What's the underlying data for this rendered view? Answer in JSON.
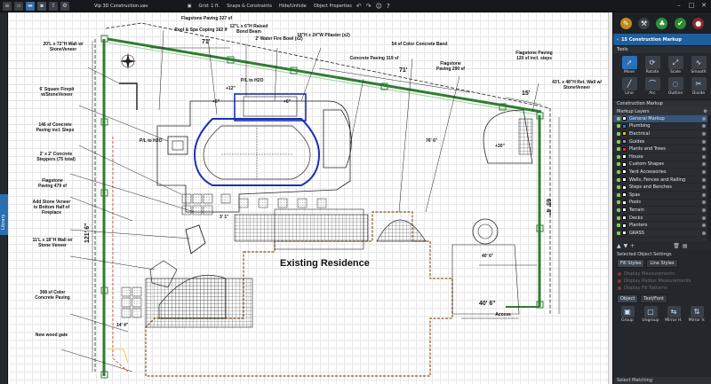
{
  "window": {
    "title": "Vip 3D Construction.uav",
    "grid_label": "Grid: 1 ft.",
    "snaps_label": "Snaps & Constraints",
    "hide_label": "Hide/Unhide",
    "props_label": "Object Properties"
  },
  "library_tab": "Library",
  "canvas": {
    "existing_label": "Existing Residence",
    "notes": [
      {
        "id": "flagstone-327",
        "text": "Flagstone Paving 327 sf"
      },
      {
        "id": "pool-spa-coping",
        "text": "Pool & Spa Coping 162 lf"
      },
      {
        "id": "raised-bond-beam",
        "text": "12\"L x 6\"H Raised Bond Beam"
      },
      {
        "id": "water-fire-bowl",
        "text": "2' Water Fire Bowl (x2)"
      },
      {
        "id": "pilaster",
        "text": "18\"H x 24\"W Pilaster (x2)"
      },
      {
        "id": "concrete-band",
        "text": "54 sf Color Concrete Band"
      },
      {
        "id": "concrete-paving-319",
        "text": "Concrete Paving 319 sf"
      },
      {
        "id": "flagstone-290",
        "text": "Flagstone Paving 290 sf"
      },
      {
        "id": "flagstone-120",
        "text": "Flagstone Paving 120 sf incl. steps"
      },
      {
        "id": "ret-wall",
        "text": "43'L x 48\"H Ret. Wall w/ StoneVeneer"
      },
      {
        "id": "wall-20",
        "text": "20'L x 72\"H Wall w/ StoneVeneer"
      },
      {
        "id": "firepit",
        "text": "6' Square Firepit w/StoneVeneer"
      },
      {
        "id": "concrete-146",
        "text": "146 sf Concrete Paving incl. Steps"
      },
      {
        "id": "steppers",
        "text": "2' x 2' Concrete Steppers (75 total)"
      },
      {
        "id": "flagstone-479",
        "text": "Flagstone Paving 479 sf"
      },
      {
        "id": "stone-veneer-fireplace",
        "text": "Add Stone Veneer to Bottom Half of Fireplace"
      },
      {
        "id": "wall-11",
        "text": "11'L x 18\"H Wall w/ Stone Veneer"
      },
      {
        "id": "color-concrete-308",
        "text": "308 sf Color Concrete Paving"
      },
      {
        "id": "wood-gate",
        "text": "New wood gate"
      },
      {
        "id": "access",
        "text": "Access"
      }
    ],
    "dimensions": {
      "top_71": "71'",
      "mid_71": "71'",
      "right_15": "15'",
      "right_side_65": "65' 4\"",
      "left_side_121": "121' 6\"",
      "bottom_40": "40' 6\"",
      "plus_12": "+12\"",
      "plus_6_left": "+6\"",
      "plus_6_right": "+6\"",
      "plus_30": "+30\"",
      "dim_76": "76' 6\"",
      "dim_31": "3' 1\"",
      "dim_14": "14' 4\"",
      "dim_40b": "40' 6\"",
      "pool_note_left": "P/L to H2O",
      "pool_note_top": "P/L to H2O"
    }
  },
  "panel": {
    "markup_name": "15 Construction Markup",
    "tools_title": "Tools",
    "tools": [
      {
        "id": "move",
        "label": "Move",
        "icon": "arrow-icon"
      },
      {
        "id": "rotate",
        "label": "Rotate",
        "icon": "rotate-icon"
      },
      {
        "id": "scale",
        "label": "Scale",
        "icon": "scale-icon"
      },
      {
        "id": "smooth",
        "label": "Smooth",
        "icon": "smooth-icon"
      },
      {
        "id": "line",
        "label": "Line",
        "icon": "line-icon"
      },
      {
        "id": "arc",
        "label": "Arc",
        "icon": "arc-icon"
      },
      {
        "id": "outline",
        "label": "Outline",
        "icon": "outline-icon"
      },
      {
        "id": "divide",
        "label": "Divide",
        "icon": "divide-icon"
      }
    ],
    "construction_markup_title": "Construction Markup",
    "markup_layers_title": "Markup Layers",
    "layers": [
      {
        "name": "General Markup",
        "color": "#ffffff",
        "active": true
      },
      {
        "name": "Plumbing",
        "color": "#3b78d6"
      },
      {
        "name": "Electrical",
        "color": "#e2c61b"
      },
      {
        "name": "Guides",
        "color": "#9b9b9b"
      },
      {
        "name": "Plants and Trees",
        "color": "#d43b2b"
      },
      {
        "name": "House",
        "color": "#ffffff"
      },
      {
        "name": "Custom Shapes",
        "color": "#ffffff"
      },
      {
        "name": "Yard Accessories",
        "color": "#ffffff"
      },
      {
        "name": "Walls, Fences and Railing",
        "color": "#ffffff"
      },
      {
        "name": "Steps and Benches",
        "color": "#ffffff"
      },
      {
        "name": "Spas",
        "color": "#ffffff"
      },
      {
        "name": "Pools",
        "color": "#ffffff"
      },
      {
        "name": "Terrain",
        "color": "#ffffff"
      },
      {
        "name": "Decks",
        "color": "#ffffff"
      },
      {
        "name": "Planters",
        "color": "#ffffff"
      },
      {
        "name": "GRASS",
        "color": "#ffffff"
      }
    ],
    "selected_settings_title": "Selected Object Settings",
    "fill_styles_tab": "Fill Styles",
    "line_styles_tab": "Line Styles",
    "disabled_options": [
      "Display Measurements",
      "Display Radius Measurements",
      "Display Fill Patterns"
    ],
    "object_tab": "Object",
    "text_font_tab": "Text/Font",
    "object_tools": [
      {
        "id": "group",
        "label": "Group"
      },
      {
        "id": "ungroup",
        "label": "Ungroup"
      },
      {
        "id": "mirror-h",
        "label": "Mirror H."
      },
      {
        "id": "mirror-v",
        "label": "Mirror V."
      }
    ],
    "select_matching": "Select Matching"
  },
  "colors": {
    "accent": "#1f5f9e",
    "panel_bg": "#24282d",
    "wall_green": "#2f7d32",
    "pool_blue": "#1c2fb3"
  }
}
